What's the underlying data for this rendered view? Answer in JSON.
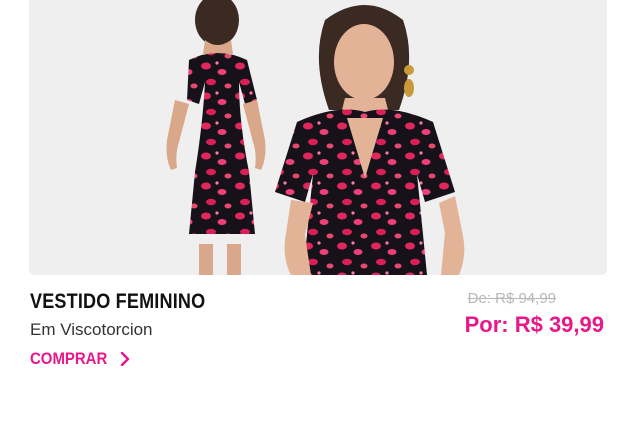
{
  "product": {
    "title": "VESTIDO FEMININO",
    "subtitle": "Em Viscotorcion",
    "buy_label": "COMPRAR",
    "old_price": "De: R$ 94,99",
    "new_price": "Por: R$ 39,99"
  },
  "colors": {
    "accent": "#e8178a",
    "title": "#111111",
    "old_price": "#b7b7b7",
    "image_background": "#efeff0",
    "dress_base": "#17121a",
    "dress_print": "#e0285c"
  },
  "icons": {
    "buy_arrow": "chevron-right-icon"
  }
}
